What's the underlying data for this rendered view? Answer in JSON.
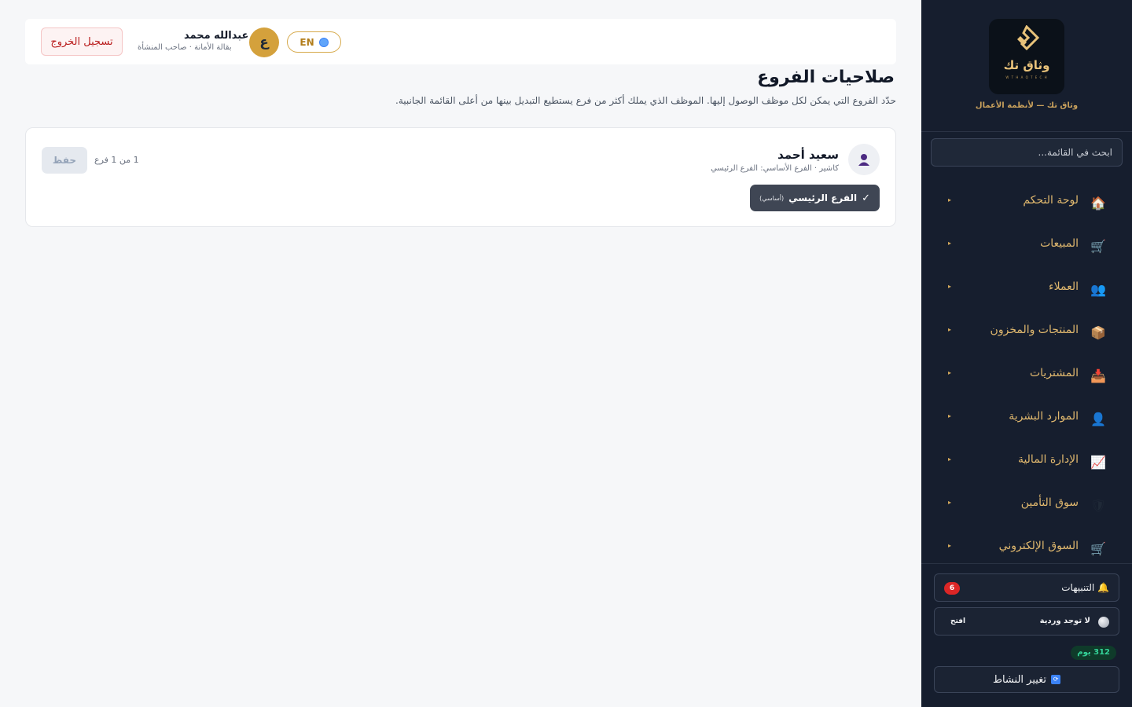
{
  "sidebar": {
    "brand": "وثاق تك",
    "brand_sub": "W T H A Q T E C H",
    "tagline": "وثاق تك — لأنظمة الأعمال",
    "search_placeholder": "ابحث في القائمة...",
    "items": [
      {
        "label": "لوحة التحكم",
        "icon": "home-icon",
        "glyph": "🏠"
      },
      {
        "label": "المبيعات",
        "icon": "cart-icon",
        "glyph": "🛒"
      },
      {
        "label": "العملاء",
        "icon": "users-icon",
        "glyph": "👥"
      },
      {
        "label": "المنتجات والمخزون",
        "icon": "box-icon",
        "glyph": "📦"
      },
      {
        "label": "المشتريات",
        "icon": "inbox-icon",
        "glyph": "📥"
      },
      {
        "label": "الموارد البشرية",
        "icon": "person-icon",
        "glyph": "👤"
      },
      {
        "label": "الإدارة المالية",
        "icon": "chart-icon",
        "glyph": "📈"
      },
      {
        "label": "سوق التأمين",
        "icon": "shield-icon",
        "glyph": "🛡"
      },
      {
        "label": "السوق الإلكتروني",
        "icon": "ecommerce-cart-icon",
        "glyph": "🛒"
      }
    ],
    "arrow": "▸",
    "notifications_label": "التنبيهات",
    "notifications_icon": "🔔",
    "notifications_count": "6",
    "shift_label": "لا توجد وردية",
    "shift_open": "افتح",
    "days": "312 يوم",
    "switch_label": "تغيير النشاط"
  },
  "header": {
    "logout": "تسجيل الخروج",
    "user_name": "عبدالله محمد",
    "user_sub": "بقالة الأمانة · صاحب المنشأة",
    "avatar_letter": "ع",
    "lang": "EN"
  },
  "page": {
    "title": "صلاحيات الفروع",
    "description": "حدّد الفروع التي يمكن لكل موظف الوصول إليها. الموظف الذي يملك أكثر من فرع يستطيع التبديل بينها من أعلى القائمة الجانبية."
  },
  "employee": {
    "name": "سعيد أحمد",
    "sub": "كاشير · الفرع الأساسي: الفرع الرئيسي",
    "branch_check": "✓",
    "branch_name": "الفرع الرئيسي",
    "branch_tag": "(أساسي)",
    "count": "1 من 1 فرع",
    "save": "حفظ"
  }
}
